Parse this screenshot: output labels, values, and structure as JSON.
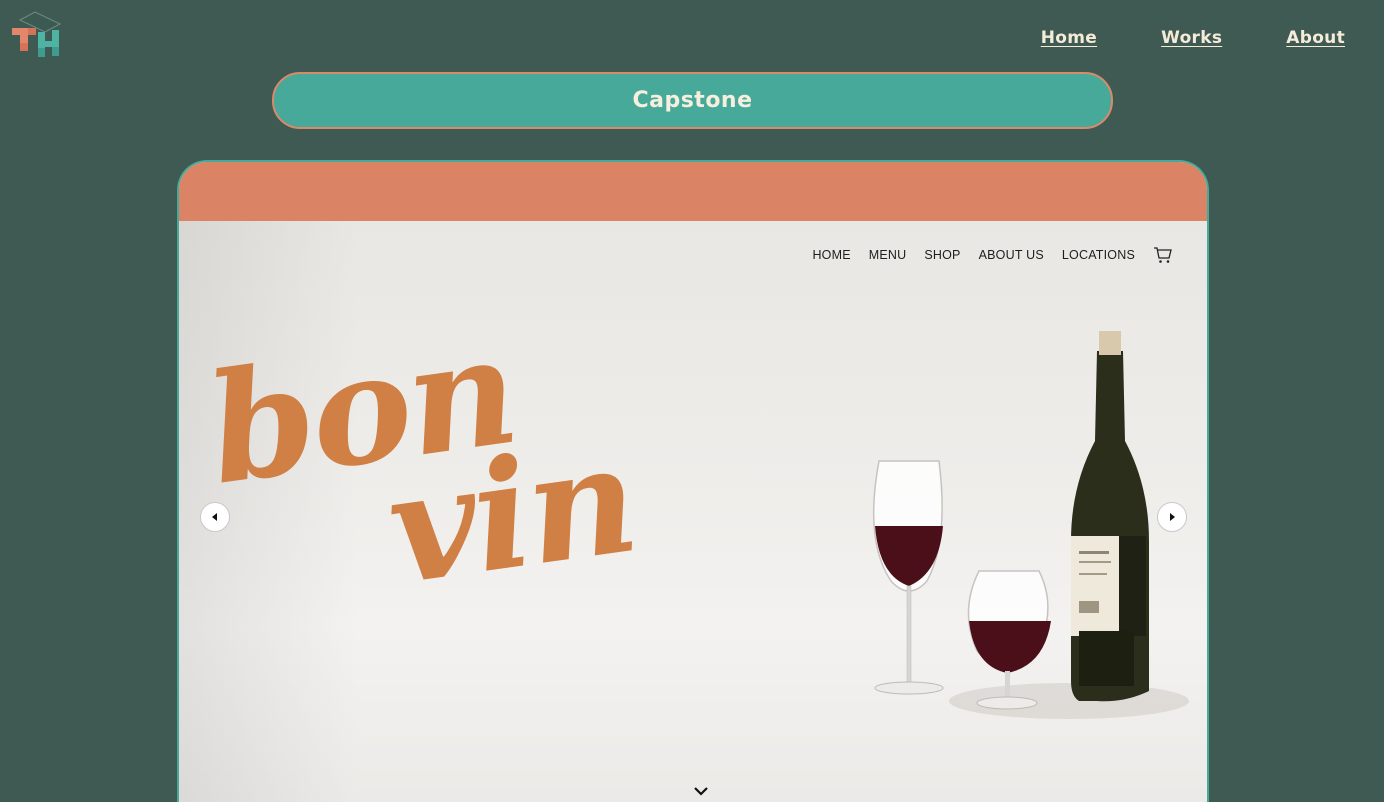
{
  "header": {
    "logo_icon": "th-block-logo-icon",
    "nav": [
      "Home",
      "Works",
      "About"
    ]
  },
  "project": {
    "title": "Capstone"
  },
  "preview": {
    "nav": [
      "HOME",
      "MENU",
      "SHOP",
      "ABOUT US",
      "LOCATIONS"
    ],
    "cart_icon": "cart-icon",
    "brand_line1": "bon",
    "brand_line2": "vin",
    "prev_icon": "arrow-left-icon",
    "next_icon": "arrow-right-icon",
    "scroll_icon": "chevron-down-icon"
  },
  "colors": {
    "page_bg": "#3f5a52",
    "pill": "#47a99a",
    "bar": "#db8465",
    "brand": "#d07f45"
  }
}
